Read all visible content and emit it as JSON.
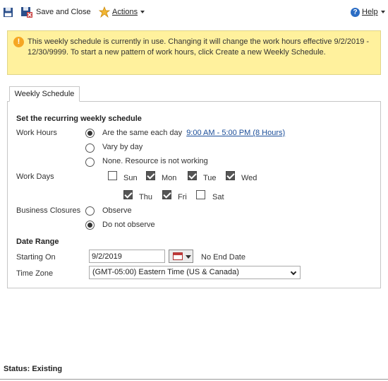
{
  "toolbar": {
    "save_label": "Save and Close",
    "actions_label": "Actions",
    "help_label": "Help"
  },
  "warning": {
    "text": "This weekly schedule is currently in use. Changing it will change the work hours effective 9/2/2019 - 12/30/9999. To start a new pattern of work hours, click Create a new Weekly Schedule."
  },
  "tab": {
    "label": "Weekly Schedule"
  },
  "schedule": {
    "section_title": "Set the recurring weekly schedule",
    "work_hours_label": "Work Hours",
    "work_hours_options": [
      {
        "text": "Are the same each day",
        "selected": true,
        "link": "9:00 AM - 5:00 PM (8 Hours)"
      },
      {
        "text": "Vary by day",
        "selected": false
      },
      {
        "text": "None. Resource is not working",
        "selected": false
      }
    ],
    "work_days_label": "Work Days",
    "days": [
      {
        "name": "Sun",
        "checked": false
      },
      {
        "name": "Mon",
        "checked": true
      },
      {
        "name": "Tue",
        "checked": true
      },
      {
        "name": "Wed",
        "checked": true
      },
      {
        "name": "Thu",
        "checked": true
      },
      {
        "name": "Fri",
        "checked": true
      },
      {
        "name": "Sat",
        "checked": false
      }
    ],
    "closures_label": "Business Closures",
    "closure_options": [
      {
        "text": "Observe",
        "selected": false
      },
      {
        "text": "Do not observe",
        "selected": true
      }
    ]
  },
  "date_range": {
    "section_title": "Date Range",
    "starting_on_label": "Starting On",
    "starting_on_value": "9/2/2019",
    "end_text": "No End Date",
    "time_zone_label": "Time Zone",
    "time_zone_value": "(GMT-05:00) Eastern Time (US & Canada)"
  },
  "status": {
    "text": "Status: Existing"
  }
}
